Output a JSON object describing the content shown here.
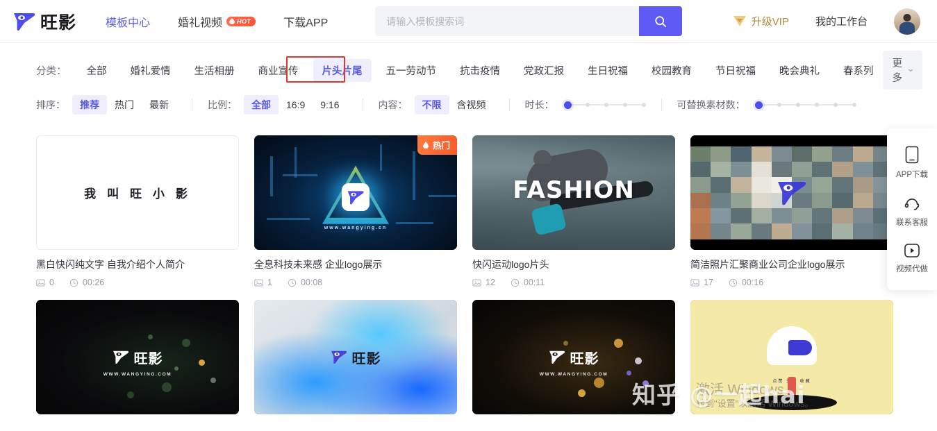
{
  "header": {
    "brand_name": "旺影",
    "brand_logo_icon": "wangying-logo-icon",
    "nav": [
      {
        "label": "模板中心",
        "active": true,
        "badge": null
      },
      {
        "label": "婚礼视频",
        "active": false,
        "badge": "HOT"
      },
      {
        "label": "下载APP",
        "active": false,
        "badge": null
      }
    ],
    "search": {
      "placeholder": "请输入模板搜索词",
      "value": "",
      "button_icon": "search-icon"
    },
    "vip_label": "升级VIP",
    "vip_icon": "diamond-icon",
    "workbench_label": "我的工作台",
    "avatar_icon": "user-avatar"
  },
  "categories": {
    "label": "分类：",
    "items": [
      {
        "label": "全部",
        "active": false
      },
      {
        "label": "婚礼爱情",
        "active": false
      },
      {
        "label": "生活相册",
        "active": false
      },
      {
        "label": "商业宣传",
        "active": false
      },
      {
        "label": "片头片尾",
        "active": true
      },
      {
        "label": "五一劳动节",
        "active": false
      },
      {
        "label": "抗击疫情",
        "active": false
      },
      {
        "label": "党政汇报",
        "active": false
      },
      {
        "label": "生日祝福",
        "active": false
      },
      {
        "label": "校园教育",
        "active": false
      },
      {
        "label": "节日祝福",
        "active": false
      },
      {
        "label": "晚会典礼",
        "active": false
      },
      {
        "label": "春系列",
        "active": false
      }
    ],
    "more_label": "更多",
    "more_icon": "chevron-down-icon",
    "highlight_color": "#e8352a"
  },
  "filters": {
    "sort": {
      "label": "排序：",
      "options": [
        {
          "label": "推荐",
          "active": true
        },
        {
          "label": "热门",
          "active": false
        },
        {
          "label": "最新",
          "active": false
        }
      ]
    },
    "ratio": {
      "label": "比例：",
      "options": [
        {
          "label": "全部",
          "active": true
        },
        {
          "label": "16:9",
          "active": false
        },
        {
          "label": "9:16",
          "active": false
        }
      ]
    },
    "content": {
      "label": "内容：",
      "options": [
        {
          "label": "不限",
          "active": true
        },
        {
          "label": "含视频",
          "active": false
        }
      ]
    },
    "duration": {
      "label": "时长：",
      "steps": 5,
      "selected_index": 0
    },
    "replaceable": {
      "label": "可替换素材数：",
      "steps": 6,
      "selected_index": 0
    }
  },
  "cards": [
    {
      "title": "黑白快闪纯文字 自我介绍个人简介",
      "clips": "0",
      "duration": "00:26",
      "hot": false,
      "thumb_text": "我 叫 旺 小 影",
      "art": "plain"
    },
    {
      "title": "全息科技未来感 企业logo展示",
      "clips": "1",
      "duration": "00:08",
      "hot": true,
      "hot_label": "热门",
      "thumb_text": "www.wangying.cn",
      "art": "tech"
    },
    {
      "title": "快闪运动logo片头",
      "clips": "12",
      "duration": "00:11",
      "hot": false,
      "thumb_text": "FASHION",
      "art": "fashion"
    },
    {
      "title": "简洁照片汇聚商业公司企业logo展示",
      "clips": "17",
      "duration": "00:16",
      "hot": false,
      "thumb_text": "",
      "art": "collage"
    },
    {
      "title": "",
      "clips": "",
      "duration": "",
      "hot": false,
      "thumb_text": "旺影",
      "sub_text": "WWW.WANGYING.COM",
      "art": "dark-green"
    },
    {
      "title": "",
      "clips": "",
      "duration": "",
      "hot": false,
      "thumb_text": "旺影",
      "sub_text": "",
      "art": "smoke"
    },
    {
      "title": "",
      "clips": "",
      "duration": "",
      "hot": false,
      "thumb_text": "旺影",
      "sub_text": "WWW.WANGYING.COM",
      "art": "dark-gold"
    },
    {
      "title": "",
      "clips": "",
      "duration": "",
      "hot": false,
      "thumb_text": "",
      "sub_text": "点赞 关注 收藏",
      "art": "yellow"
    }
  ],
  "card_meta_icons": {
    "clips": "image-icon",
    "duration": "clock-icon"
  },
  "float_panel": [
    {
      "label": "APP下载",
      "icon": "mobile-phone-icon"
    },
    {
      "label": "联系客服",
      "icon": "headset-icon"
    },
    {
      "label": "视频代做",
      "icon": "play-circle-icon"
    }
  ],
  "watermarks": {
    "zhihu": "知乎 @一起hai",
    "windows_line1": "激活 Windows",
    "windows_line2": "转到\"设置\"以激活 Windows。"
  },
  "colors": {
    "accent": "#5d5af5",
    "accent_soft": "#eeeefc",
    "hot": "#fc5b2b",
    "vip": "#b08a3e",
    "annotation": "#e8352a"
  }
}
